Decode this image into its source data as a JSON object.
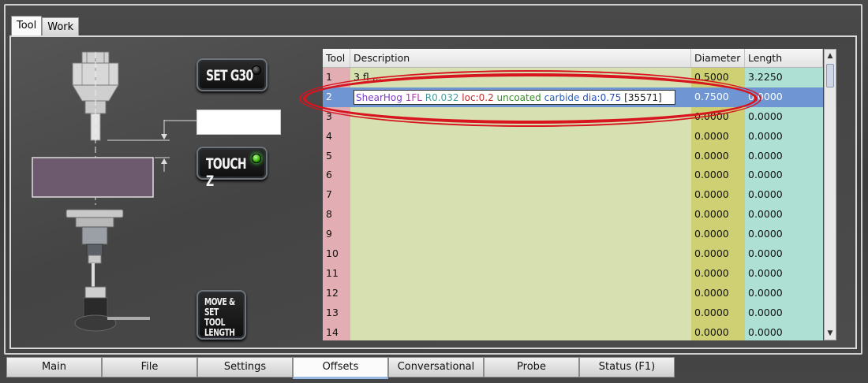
{
  "top_tabs": [
    "Tool",
    "Work"
  ],
  "buttons": {
    "set_g30": "SET G30",
    "touch_z": "TOUCH Z",
    "move_set_length": [
      "MOVE &",
      "SET TOOL",
      "LENGTH"
    ]
  },
  "indicators": {
    "set_g30_led": "off",
    "touch_z_led": "on"
  },
  "table": {
    "headers": [
      "Tool",
      "Description",
      "Diameter",
      "Length"
    ],
    "rows": [
      {
        "tool": "1",
        "desc": "3 fl ...",
        "dia": "0.5000",
        "len": "3.2250"
      },
      {
        "tool": "2",
        "desc": "",
        "dia": "0.7500",
        "len": "0.0000",
        "selected": true
      },
      {
        "tool": "3",
        "desc": "",
        "dia": "0.0000",
        "len": "0.0000"
      },
      {
        "tool": "4",
        "desc": "",
        "dia": "0.0000",
        "len": "0.0000"
      },
      {
        "tool": "5",
        "desc": "",
        "dia": "0.0000",
        "len": "0.0000"
      },
      {
        "tool": "6",
        "desc": "",
        "dia": "0.0000",
        "len": "0.0000"
      },
      {
        "tool": "7",
        "desc": "",
        "dia": "0.0000",
        "len": "0.0000"
      },
      {
        "tool": "8",
        "desc": "",
        "dia": "0.0000",
        "len": "0.0000"
      },
      {
        "tool": "9",
        "desc": "",
        "dia": "0.0000",
        "len": "0.0000"
      },
      {
        "tool": "10",
        "desc": "",
        "dia": "0.0000",
        "len": "0.0000"
      },
      {
        "tool": "11",
        "desc": "",
        "dia": "0.0000",
        "len": "0.0000"
      },
      {
        "tool": "12",
        "desc": "",
        "dia": "0.0000",
        "len": "0.0000"
      },
      {
        "tool": "13",
        "desc": "",
        "dia": "0.0000",
        "len": "0.0000"
      },
      {
        "tool": "14",
        "desc": "",
        "dia": "0.0000",
        "len": "0.0000"
      }
    ],
    "edit_text": {
      "name": "ShearHog",
      "flutes": "1FL",
      "radius": "R0.032",
      "loc": "loc:0.2",
      "coating": "uncoated",
      "material": "carbide",
      "dia": "dia:0.75",
      "id": "[35571]"
    }
  },
  "colors": {
    "highlight": "#d8141f",
    "selection": "#6f95d2"
  },
  "bottom_tabs": [
    "Main",
    "File",
    "Settings",
    "Offsets",
    "Conversational",
    "Probe",
    "Status (F1)"
  ],
  "active_bottom_tab": "Offsets"
}
